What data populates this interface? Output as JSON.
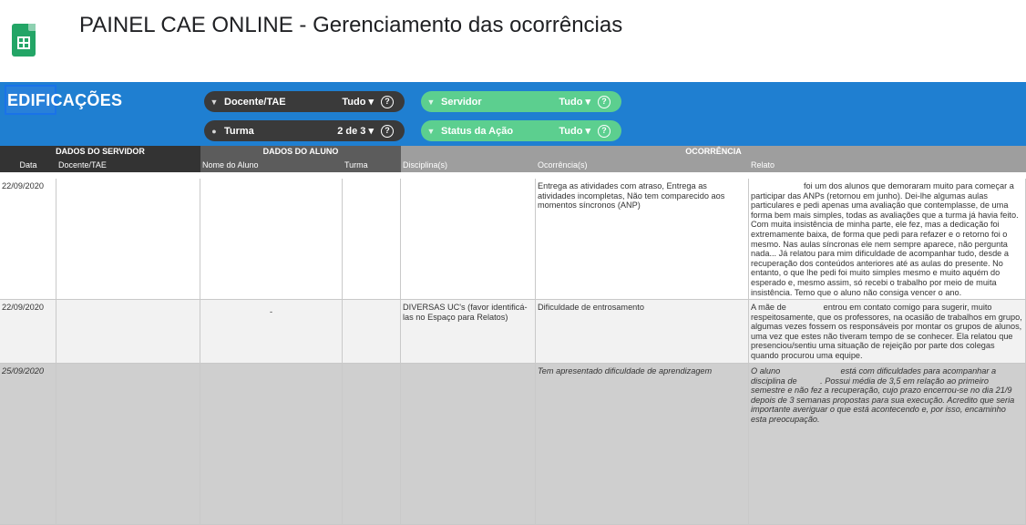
{
  "doc": {
    "title": "PAINEL CAE ONLINE - Gerenciamento das ocorrências"
  },
  "banner": {
    "brand": "EDIFICAÇÕES",
    "filters": [
      {
        "label": "Docente/TAE",
        "value": "Tudo ▾",
        "icon": "filter-icon"
      },
      {
        "label": "Turma",
        "value": "2 de 3 ▾",
        "icon": "filter-icon"
      },
      {
        "label": "Servidor",
        "value": "Tudo ▾",
        "icon": "filter-icon"
      },
      {
        "label": "Status da Ação",
        "value": "Tudo ▾",
        "icon": "filter-icon"
      }
    ],
    "help": "?"
  },
  "headers": {
    "group": [
      "DADOS DO SERVIDOR",
      "DADOS DO ALUNO",
      "OCORRÊNCIA"
    ],
    "columns": [
      "Data",
      "Docente/TAE",
      "Nome do Aluno",
      "Turma",
      "Disciplina(s)",
      "Ocorrência(s)",
      "Relato"
    ]
  },
  "rows": [
    {
      "date": "22/09/2020",
      "docente": "",
      "aluno": "",
      "turma": "",
      "disciplina": "",
      "ocorrencia": "Entrega as atividades com atraso, Entrega as atividades incompletas, Não tem comparecido aos momentos síncronos (ANP)",
      "relato": "foi um dos alunos que demoraram muito para começar a participar das ANPs (retornou em junho). Dei-lhe algumas aulas particulares e pedi apenas uma avaliação que contemplasse, de uma forma bem mais simples, todas as avaliações que a turma já havia feito. Com muita insistência de minha parte, ele fez, mas a dedicação foi extremamente baixa, de forma que pedi para refazer e o retorno foi o mesmo. Nas aulas síncronas ele nem sempre aparece, não pergunta nada... Já relatou para mim dificuldade de acompanhar tudo, desde a recuperação dos conteúdos anteriores até as aulas do presente. No entanto, o que lhe pedi foi muito simples mesmo e muito aquém do esperado e, mesmo assim, só recebi o trabalho por meio de muita insistência. Temo que o aluno não consiga vencer o ano."
    },
    {
      "date": "22/09/2020",
      "docente": "",
      "aluno": "-",
      "turma": "",
      "disciplina": "DIVERSAS UC's (favor identificá-las no Espaço para Relatos)",
      "ocorrencia": "Dificuldade de entrosamento",
      "relato": "A mãe de                entrou em contato comigo para sugerir, muito respeitosamente, que os professores, na ocasião de trabalhos em grupo, algumas vezes fossem os responsáveis por montar os grupos de alunos, uma vez que estes não tiveram tempo de se conhecer. Ela relatou que presenciou/sentiu uma situação de rejeição por parte dos colegas quando procurou uma equipe."
    },
    {
      "date": "25/09/2020",
      "docente": "",
      "aluno": "",
      "turma": "",
      "disciplina": "",
      "ocorrencia": "Tem apresentado dificuldade de aprendizagem",
      "relato": "O aluno                          está com dificuldades para acompanhar a disciplina de          . Possui média de 3,5 em relação ao primeiro semestre e não fez a recuperação, cujo prazo encerrou-se no dia 21/9 depois de 3 semanas propostas para sua execução. Acredito que seria importante averiguar o que está acontecendo e, por isso, encaminho esta preocupação."
    }
  ],
  "colors": {
    "banner": "#1f7fd1",
    "chip_dark": "#3a3a3a",
    "chip_green": "#5ccf8f",
    "header_dark": "#333333",
    "header_gray": "#5c5c5c",
    "header_light": "#9e9e9e",
    "row_white": "#ffffff",
    "row_light": "#f2f2f2",
    "row_gray": "#cfcfcf"
  }
}
